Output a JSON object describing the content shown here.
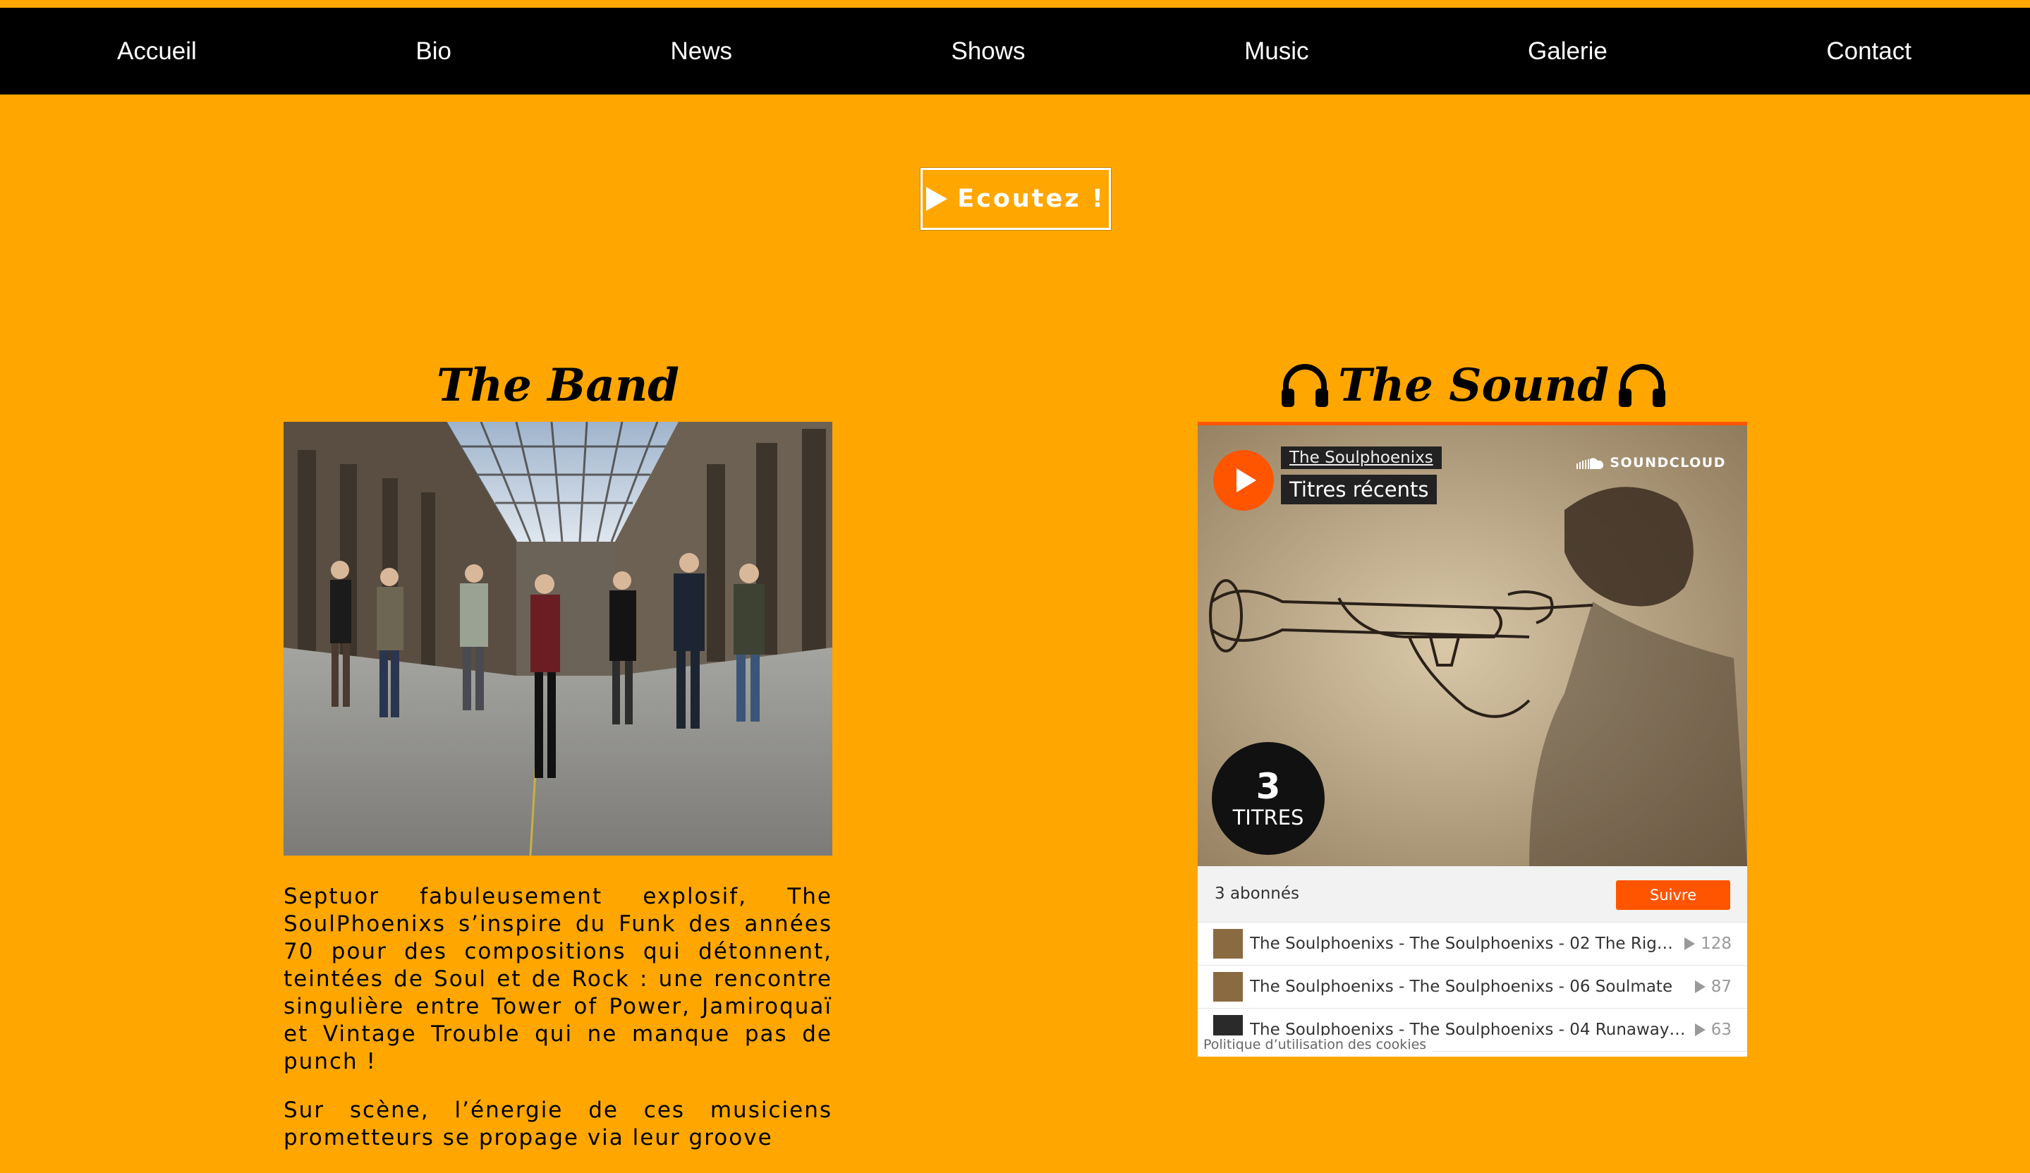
{
  "nav": {
    "items": [
      "Accueil",
      "Bio",
      "News",
      "Shows",
      "Music",
      "Galerie",
      "Contact"
    ]
  },
  "listen_button": {
    "label": "Ecoutez !"
  },
  "band": {
    "title": "The Band",
    "bio": [
      "Septuor fabuleusement explosif, The SoulPhoenixs s’inspire du Funk des années 70 pour des compositions qui détonnent, teintées de Soul et de Rock : une rencontre singulière entre Tower of Power, Jamiroquaï et Vintage Trouble qui ne manque pas de punch !",
      "Sur scène, l’énergie de ces musiciens prometteurs se propage via leur groove"
    ]
  },
  "sound": {
    "title": "The Sound",
    "widget": {
      "user": "The Soulphoenixs",
      "set_title": "Titres récents",
      "brand": "SOUNDCLOUD",
      "count_number": "3",
      "count_label": "TITRES",
      "followers": "3 abonnés",
      "follow_label": "Suivre",
      "tracks": [
        {
          "title": "The Soulphoenixs - The Soulphoenixs - 02 The Right...",
          "plays": "128"
        },
        {
          "title": "The Soulphoenixs - The Soulphoenixs - 06 Soulmate",
          "plays": "87"
        },
        {
          "title": "The Soulphoenixs - The Soulphoenixs - 04 Runaway G...",
          "plays": "63"
        }
      ],
      "cookie_policy": "Politique d’utilisation des cookies"
    }
  },
  "colors": {
    "background": "#ffa700",
    "navbar": "#000000",
    "soundcloud_orange": "#ff5500"
  }
}
